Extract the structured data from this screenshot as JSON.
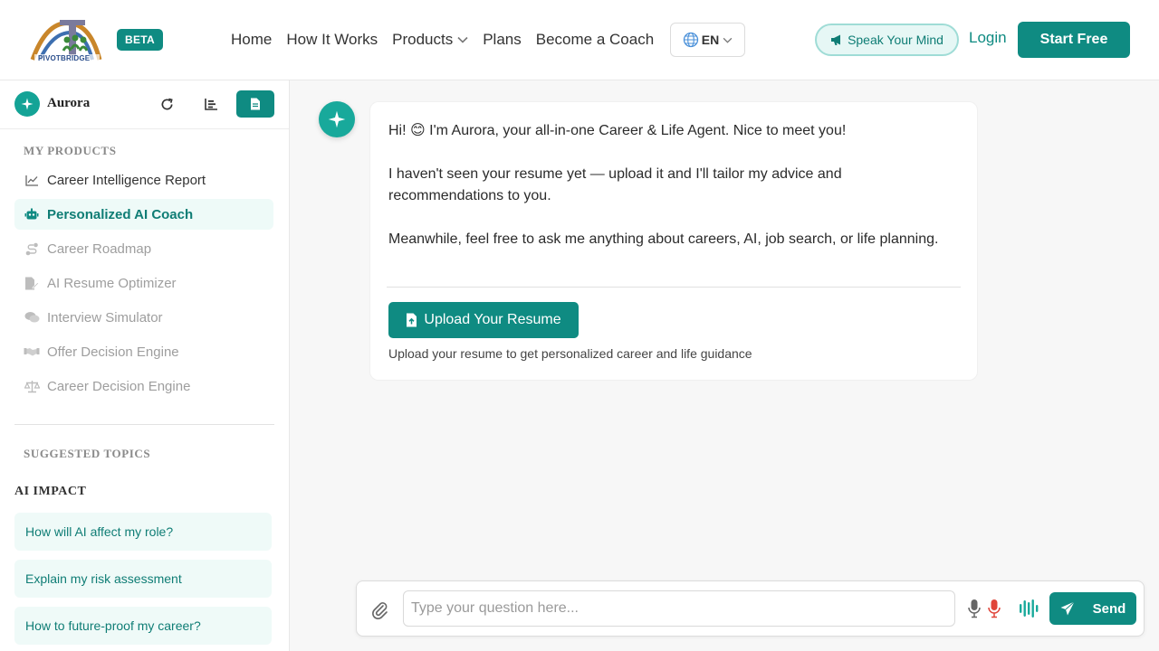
{
  "header": {
    "logo_text": "PIVOTBRIDGE",
    "beta_badge": "BETA",
    "nav": [
      {
        "label": "Home"
      },
      {
        "label": "How It Works"
      },
      {
        "label": "Products"
      },
      {
        "label": "Plans"
      },
      {
        "label": "Become a Coach"
      }
    ],
    "language": "EN",
    "speak_label": "Speak Your Mind",
    "login_label": "Login",
    "start_label": "Start Free"
  },
  "sidebar": {
    "agent_name": "Aurora",
    "products_title": "MY PRODUCTS",
    "products": [
      {
        "label": "Career Intelligence Report",
        "icon": "chart-line-icon",
        "state": "normal"
      },
      {
        "label": "Personalized AI Coach",
        "icon": "robot-icon",
        "state": "active"
      },
      {
        "label": "Career Roadmap",
        "icon": "route-icon",
        "state": "muted"
      },
      {
        "label": "AI Resume Optimizer",
        "icon": "file-edit-icon",
        "state": "muted"
      },
      {
        "label": "Interview Simulator",
        "icon": "comments-icon",
        "state": "muted"
      },
      {
        "label": "Offer Decision Engine",
        "icon": "handshake-icon",
        "state": "muted"
      },
      {
        "label": "Career Decision Engine",
        "icon": "scale-icon",
        "state": "muted"
      }
    ],
    "topics_title": "SUGGESTED TOPICS",
    "topic_category": "AI IMPACT",
    "topics": [
      {
        "label": "How will AI affect my role?"
      },
      {
        "label": "Explain my risk assessment"
      },
      {
        "label": "How to future-proof my career?"
      }
    ]
  },
  "chat": {
    "greeting": "Hi! 😊 I'm Aurora, your all-in-one Career & Life Agent. Nice to meet you!",
    "resume_note": "I haven't seen your resume yet — upload it and I'll tailor my advice and recommendations to you.",
    "meanwhile": "Meanwhile, feel free to ask me anything about careers, AI, job search, or life planning.",
    "upload_label": "Upload Your Resume",
    "upload_hint": "Upload your resume to get personalized career and life guidance"
  },
  "composer": {
    "placeholder": "Type your question here...",
    "value": "",
    "send_label": "Send"
  },
  "colors": {
    "accent": "#0f8b82",
    "accent_light": "#eefaf8",
    "mic_red": "#e0453a"
  }
}
